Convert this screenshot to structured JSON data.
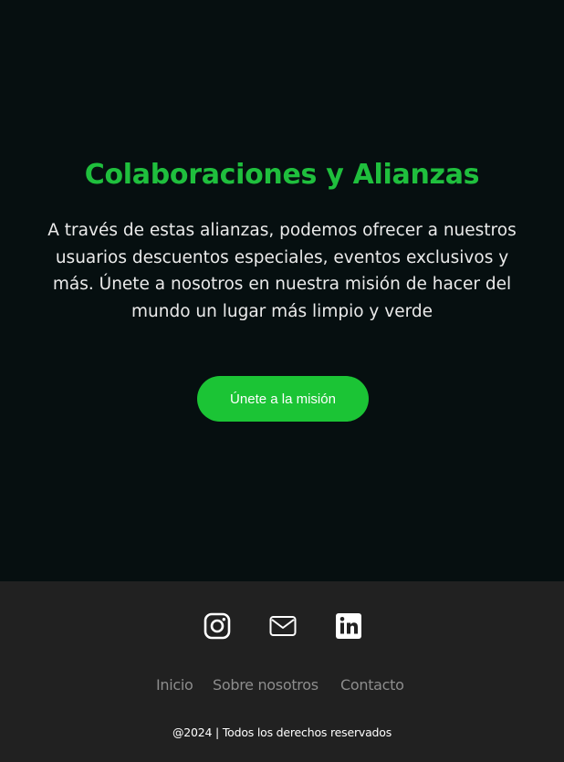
{
  "hero": {
    "title": "Colaboraciones y Alianzas",
    "description": "A través de estas alianzas, podemos ofrecer a nuestros usuarios descuentos especiales, eventos exclusivos y más. Únete a nosotros en nuestra misión de hacer del mundo un lugar más limpio y verde",
    "cta_label": "Únete a la misión"
  },
  "footer": {
    "social_icons": [
      "instagram-icon",
      "mail-icon",
      "linkedin-icon"
    ],
    "nav": {
      "inicio": "Inicio",
      "sobre": "Sobre nosotros",
      "contacto": "Contacto"
    },
    "copyright": "@2024 | Todos los derechos reservados"
  },
  "colors": {
    "accent_green": "#1bc435",
    "title_green": "#1fbf3d",
    "hero_bg": "#060f10",
    "footer_bg": "#212121"
  }
}
